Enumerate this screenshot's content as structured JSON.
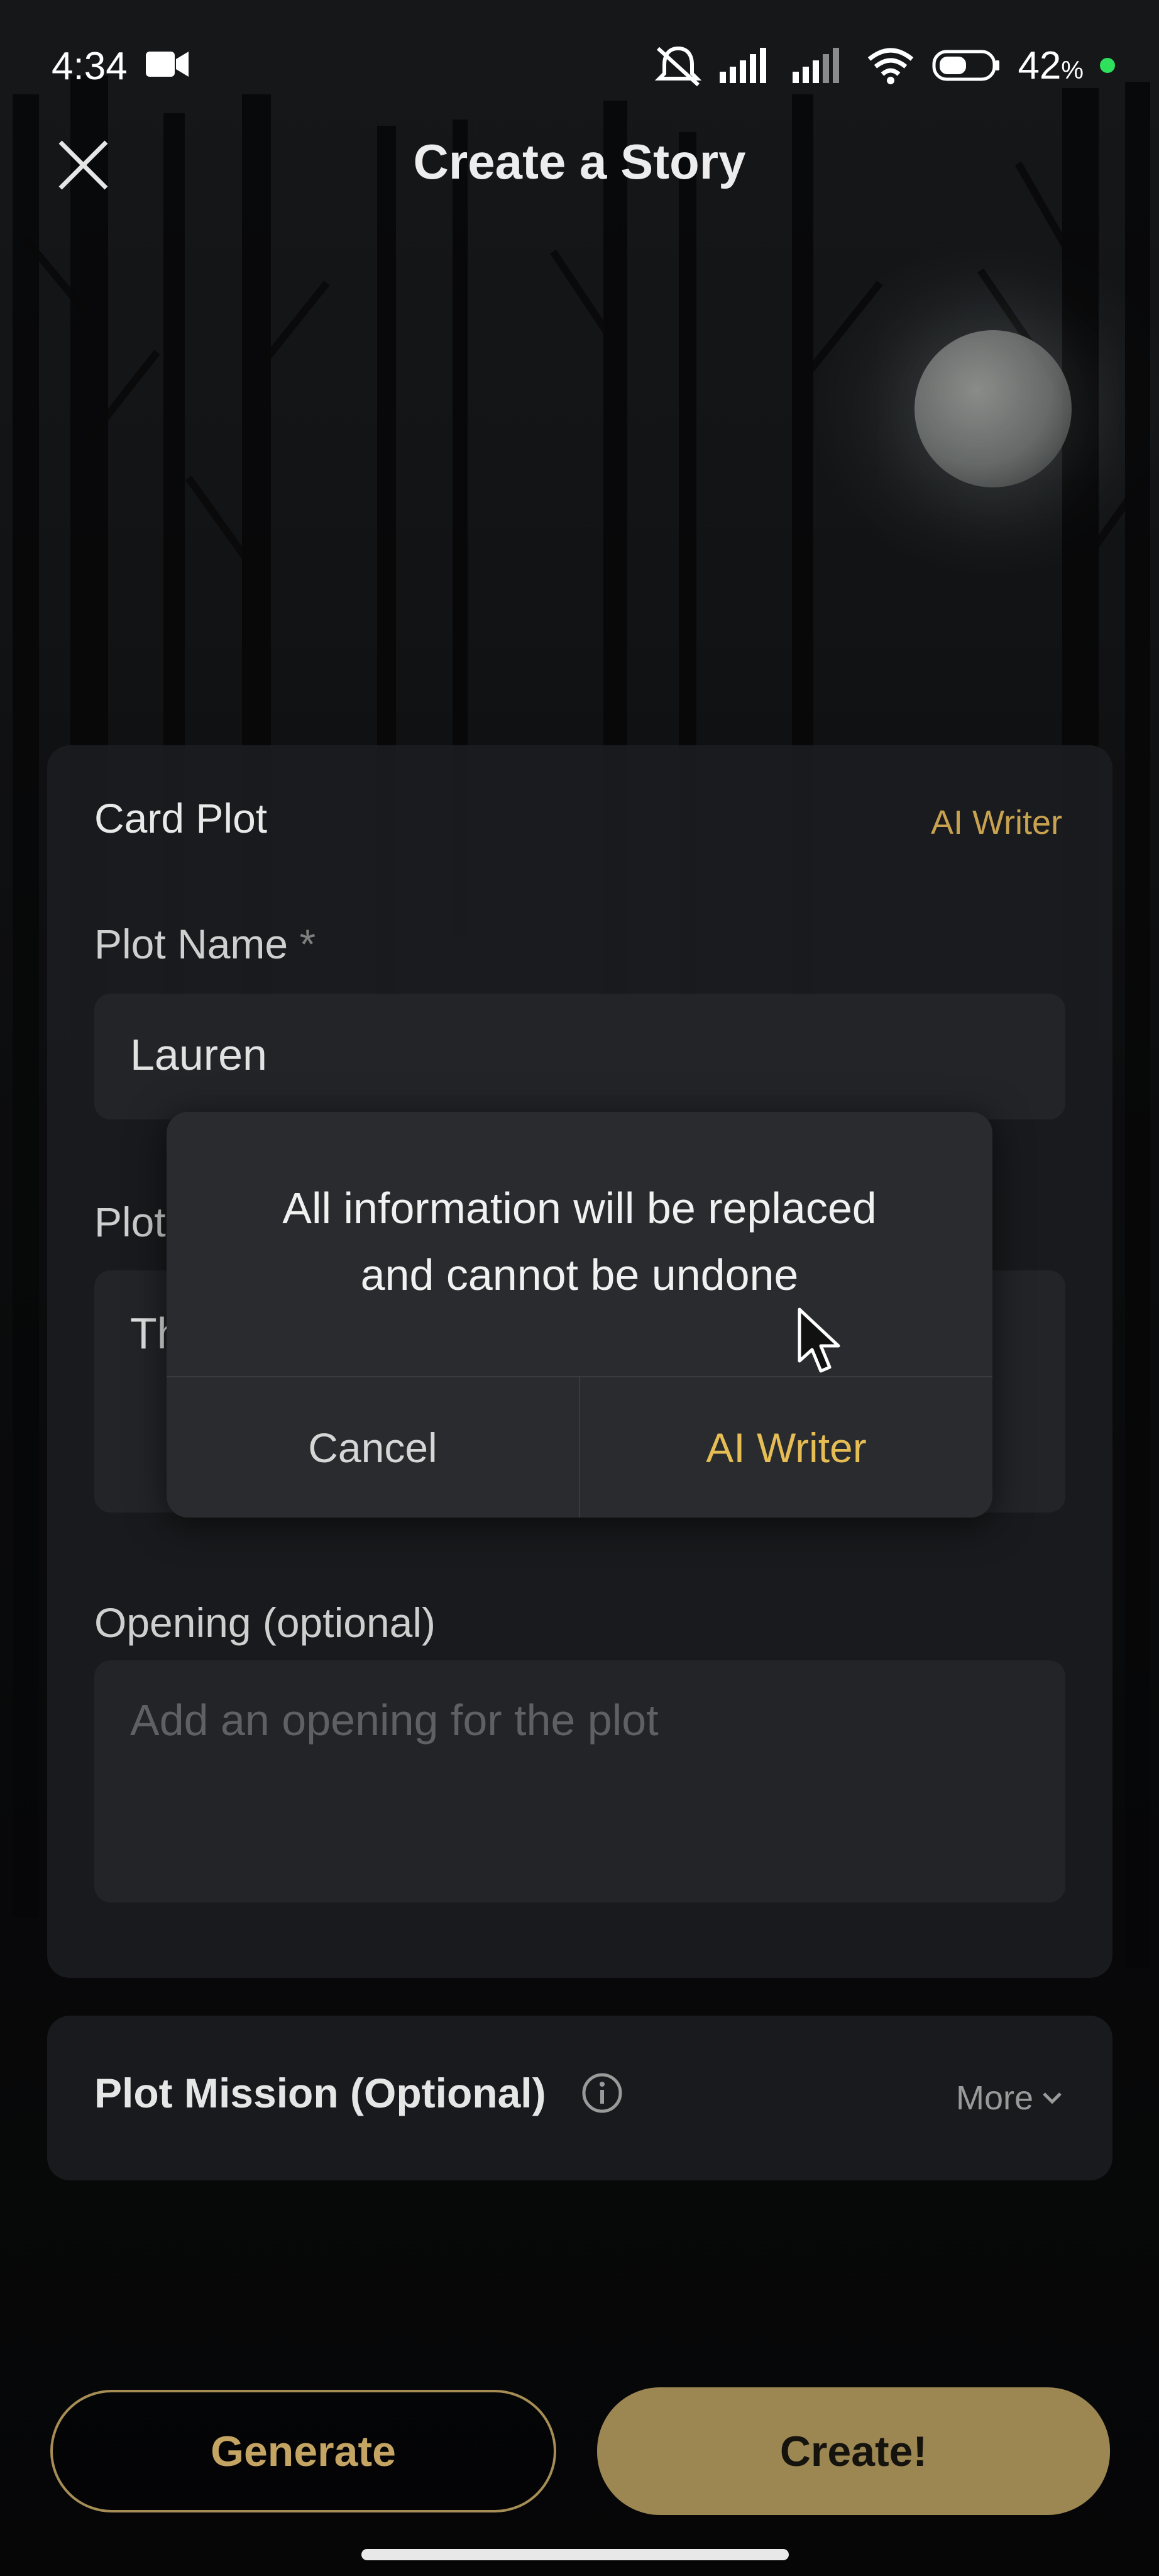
{
  "status_bar": {
    "time": "4:34",
    "battery_percent": "42",
    "battery_unit": "%",
    "icons": [
      "video-camera-icon",
      "mute-icon",
      "signal-icon",
      "signal-icon",
      "wifi-icon",
      "battery-icon"
    ]
  },
  "header": {
    "title": "Create a Story",
    "close_icon": "close-icon"
  },
  "card": {
    "title": "Card Plot",
    "ai_writer_label": "AI Writer",
    "plot_name_label": "Plot Name",
    "required_mark": "*",
    "plot_name_value": "Lauren",
    "plot_label_partial": "Plot",
    "plot_value_partial": "Th",
    "opening_label": "Opening (optional)",
    "opening_placeholder": "Add an opening for the plot"
  },
  "mission": {
    "title": "Plot Mission (Optional)",
    "more_label": "More"
  },
  "buttons": {
    "generate": "Generate",
    "create": "Create!"
  },
  "dialog": {
    "message": "All information will be replaced\nand cannot be undone",
    "cancel_label": "Cancel",
    "confirm_label": "AI Writer"
  },
  "colors": {
    "accent_gold": "#c8a24f",
    "create_button_bg": "#9c8651",
    "dialog_confirm": "#e6bd55"
  }
}
